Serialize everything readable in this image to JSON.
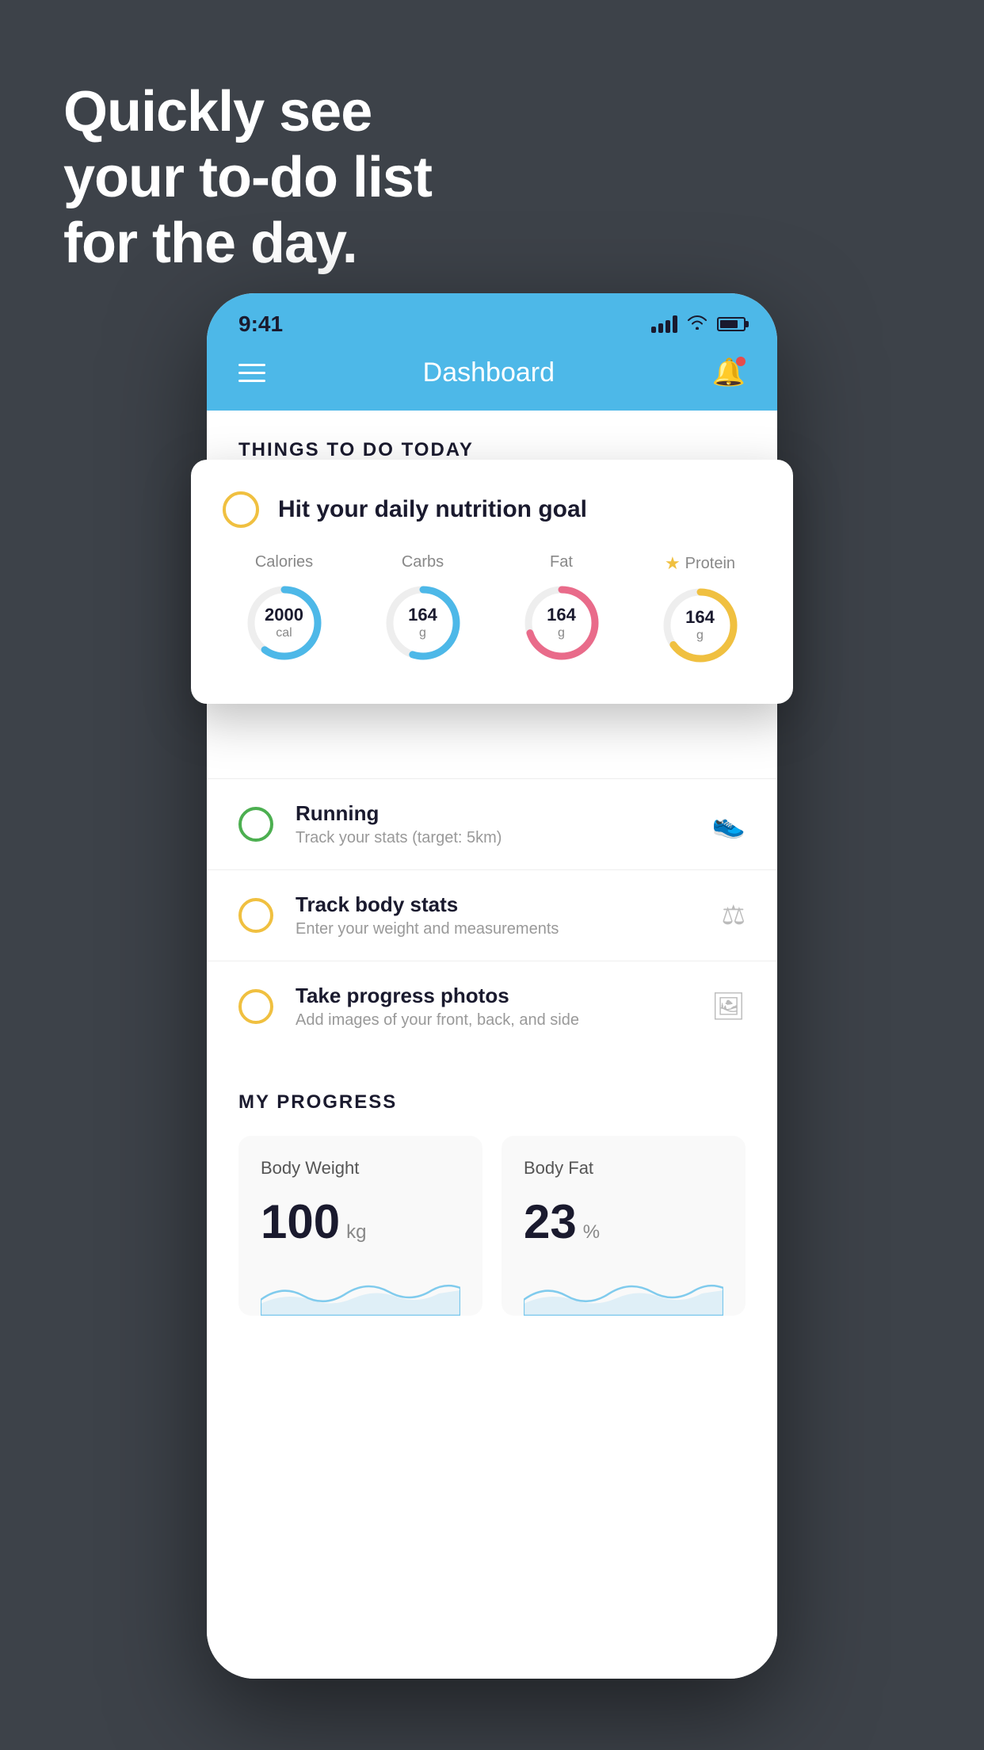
{
  "headline": {
    "line1": "Quickly see",
    "line2": "your to-do list",
    "line3": "for the day."
  },
  "statusBar": {
    "time": "9:41"
  },
  "header": {
    "title": "Dashboard"
  },
  "thingsToDoSection": {
    "label": "THINGS TO DO TODAY"
  },
  "nutritionCard": {
    "title": "Hit your daily nutrition goal",
    "items": [
      {
        "label": "Calories",
        "value": "2000",
        "unit": "cal",
        "color": "#4db8e8",
        "starred": false,
        "percent": 60
      },
      {
        "label": "Carbs",
        "value": "164",
        "unit": "g",
        "color": "#4db8e8",
        "starred": false,
        "percent": 55
      },
      {
        "label": "Fat",
        "value": "164",
        "unit": "g",
        "color": "#e96b8a",
        "starred": false,
        "percent": 70
      },
      {
        "label": "Protein",
        "value": "164",
        "unit": "g",
        "color": "#f0c040",
        "starred": true,
        "percent": 65
      }
    ]
  },
  "tasks": [
    {
      "name": "Running",
      "sub": "Track your stats (target: 5km)",
      "circleColor": "green",
      "icon": "👟"
    },
    {
      "name": "Track body stats",
      "sub": "Enter your weight and measurements",
      "circleColor": "yellow",
      "icon": "⚖"
    },
    {
      "name": "Take progress photos",
      "sub": "Add images of your front, back, and side",
      "circleColor": "yellow",
      "icon": "🖼"
    }
  ],
  "progressSection": {
    "title": "MY PROGRESS",
    "cards": [
      {
        "title": "Body Weight",
        "value": "100",
        "unit": "kg"
      },
      {
        "title": "Body Fat",
        "value": "23",
        "unit": "%"
      }
    ]
  }
}
